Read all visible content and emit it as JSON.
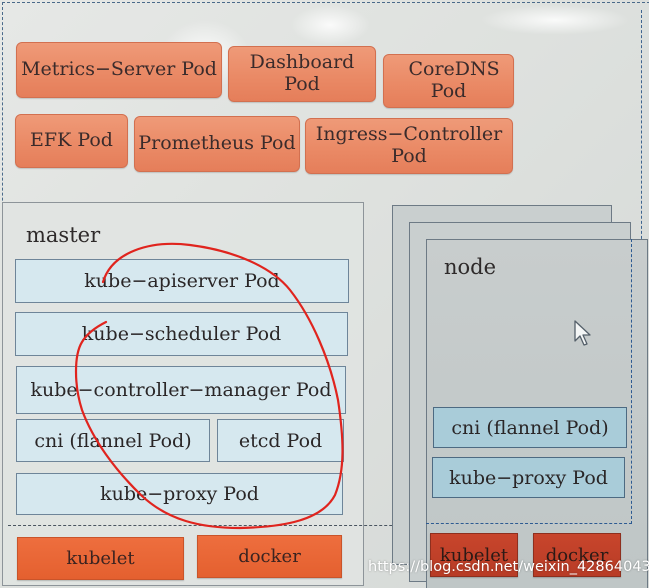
{
  "addons": {
    "metrics_server": "Metrics−Server Pod",
    "dashboard": "Dashboard Pod",
    "coredns": "CoreDNS Pod",
    "efk": "EFK Pod",
    "prometheus": "Prometheus Pod",
    "ingress_controller": "Ingress−Controller Pod"
  },
  "master": {
    "title": "master",
    "pods": {
      "apiserver": "kube−apiserver Pod",
      "scheduler": "kube−scheduler Pod",
      "controller_manager": "kube−controller−manager Pod",
      "cni": "cni (flannel  Pod)",
      "etcd": "etcd Pod",
      "proxy": "kube−proxy Pod"
    },
    "runtime": {
      "kubelet": "kubelet",
      "docker": "docker"
    }
  },
  "node": {
    "title": "node",
    "pods": {
      "cni": "cni (flannel  Pod)",
      "proxy": "kube−proxy Pod"
    },
    "runtime": {
      "kubelet": "kubelet",
      "docker": "docker"
    }
  },
  "annotation": {
    "color": "#e0241e",
    "description": "hand-drawn red circle around master control-plane pods"
  },
  "colors": {
    "addon_pod": "#ea8a66",
    "master_pod": "#d6e8ef",
    "node_pod": "#a9ccd9",
    "runtime": "#e4602f"
  },
  "watermark": "https://blog.csdn.net/weixin_42864043"
}
